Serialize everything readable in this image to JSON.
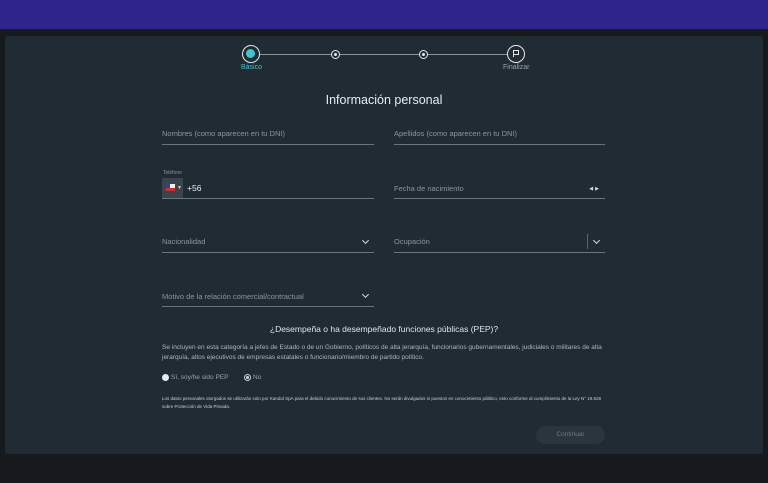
{
  "stepper": {
    "steps": [
      {
        "label": "Básico",
        "state": "active"
      },
      {
        "label": "",
        "state": "pending"
      },
      {
        "label": "",
        "state": "pending"
      },
      {
        "label": "Finalizar",
        "state": "pending"
      }
    ]
  },
  "form": {
    "title": "Información personal",
    "nombres_placeholder": "Nombres (como aparecen en tu DNI)",
    "apellidos_placeholder": "Apellidos (como aparecen en tu DNI)",
    "telefono_label": "Teléfono",
    "telefono_prefix": "+56",
    "telefono_country": "Chile",
    "fecha_placeholder": "Fecha de nacimiento",
    "nacionalidad_placeholder": "Nacionalidad",
    "ocupacion_placeholder": "Ocupación",
    "motivo_placeholder": "Motivo de la relación comercial/contractual"
  },
  "pep": {
    "question": "¿Desempeña o ha desempeñado funciones públicas (PEP)?",
    "description": "Se incluyen en esta categoría a jefes de Estado o de un Gobierno, políticos de alta jerarquía, funcionarios gubernamentales, judiciales o militares de alta jerarquía, altos ejecutivos de empresas estatales o funcionario/miembro de partido político.",
    "option_si": "Sí, soy/he sido PEP",
    "option_no": "No",
    "selected": "No"
  },
  "legal": "Los datos personales otorgados se utilizarán solo por Kandul SpA para el debido conocimiento de sus clientes. No serán divulgados ni puestos en conocimiento público, esto conforme al cumplimiento de la Ley N° 19.628 sobre Protección de Vida Privada.",
  "actions": {
    "continuar": "Continuar"
  },
  "colors": {
    "header": "#2f248c",
    "card": "#212b33",
    "accent": "#3ec5d0"
  }
}
